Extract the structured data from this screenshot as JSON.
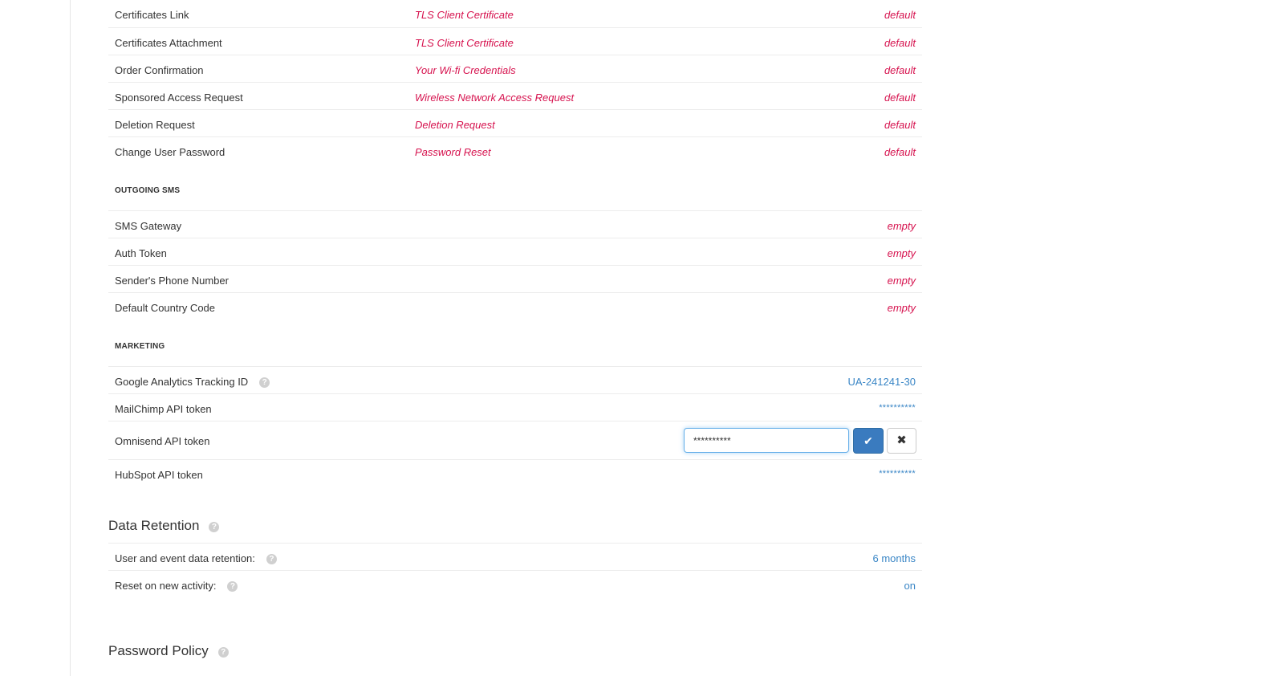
{
  "templates": [
    {
      "label": "Certificates Link",
      "template": "TLS Client Certificate",
      "value": "default"
    },
    {
      "label": "Certificates Attachment",
      "template": "TLS Client Certificate",
      "value": "default"
    },
    {
      "label": "Order Confirmation",
      "template": "Your Wi-fi Credentials",
      "value": "default"
    },
    {
      "label": "Sponsored Access Request",
      "template": "Wireless Network Access Request",
      "value": "default"
    },
    {
      "label": "Deletion Request",
      "template": "Deletion Request",
      "value": "default"
    },
    {
      "label": "Change User Password",
      "template": "Password Reset",
      "value": "default"
    }
  ],
  "outgoing_sms": {
    "header": "OUTGOING SMS",
    "rows": [
      {
        "label": "SMS Gateway",
        "value": "empty"
      },
      {
        "label": "Auth Token",
        "value": "empty"
      },
      {
        "label": "Sender's Phone Number",
        "value": "empty"
      },
      {
        "label": "Default Country Code",
        "value": "empty"
      }
    ]
  },
  "marketing": {
    "header": "MARKETING",
    "ga_label": "Google Analytics Tracking ID",
    "ga_value": "UA-241241-30",
    "mailchimp_label": "MailChimp API token",
    "mailchimp_value": "**********",
    "omnisend_label": "Omnisend API token",
    "omnisend_input_value": "**********",
    "hubspot_label": "HubSpot API token",
    "hubspot_value": "**********",
    "icons": {
      "help": "question-circle-icon",
      "confirm": "check-icon",
      "cancel": "times-icon"
    }
  },
  "data_retention": {
    "title": "Data Retention",
    "retention_label": "User and event data retention:",
    "retention_value": "6 months",
    "reset_label": "Reset on new activity:",
    "reset_value": "on"
  },
  "password_policy": {
    "title": "Password Policy"
  },
  "colors": {
    "template_red": "#d6124e",
    "link_blue": "#3a86c6",
    "primary_button": "#3a7bbf"
  }
}
